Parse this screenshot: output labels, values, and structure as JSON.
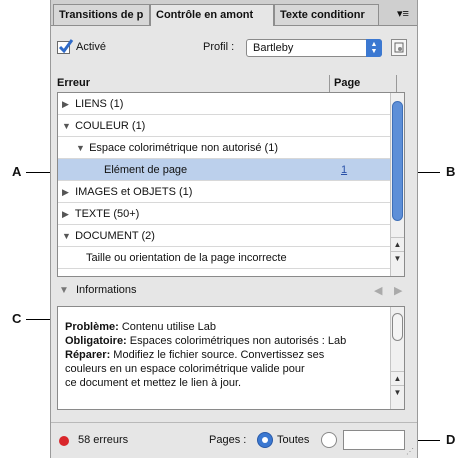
{
  "tabs": [
    "Transitions de p",
    "Contrôle en amont",
    "Texte conditionr"
  ],
  "menu_icon": "≡",
  "active_label": "Activé",
  "profile": {
    "label": "Profil :",
    "value": "Bartleby"
  },
  "columns": {
    "error": "Erreur",
    "page": "Page"
  },
  "rows": [
    {
      "label": "LIENS (1)",
      "expanded": false,
      "indent": 0
    },
    {
      "label": "COULEUR (1)",
      "expanded": true,
      "indent": 0
    },
    {
      "label": "Espace colorimétrique non autorisé (1)",
      "expanded": true,
      "indent": 1
    },
    {
      "label": "Elément de page",
      "page": "1",
      "indent": 2,
      "selected": true
    },
    {
      "label": "IMAGES et OBJETS (1)",
      "expanded": false,
      "indent": 0
    },
    {
      "label": "TEXTE (50+)",
      "expanded": false,
      "indent": 0
    },
    {
      "label": "DOCUMENT (2)",
      "expanded": true,
      "indent": 0
    },
    {
      "label": "Taille ou orientation de la page incorrecte",
      "indent": 1
    }
  ],
  "info_header": "Informations",
  "info": {
    "probleme_label": "Problème:",
    "probleme": " Contenu utilise Lab",
    "obligatoire_label": "Obligatoire:",
    "obligatoire": " Espaces colorimétriques non autorisés : Lab",
    "reparer_label": "Réparer:",
    "reparer_line1": " Modifiez le fichier source. Convertissez ses",
    "reparer_line2": "couleurs en un espace colorimétrique valide pour",
    "reparer_line3": "ce document et mettez le lien à jour."
  },
  "status": {
    "errors": "58 erreurs",
    "pages_label": "Pages :",
    "toutes": "Toutes",
    "status_color": "#d9262b"
  },
  "callouts": {
    "a": "A",
    "b": "B",
    "c": "C",
    "d": "D"
  },
  "accent": "#3b78d1"
}
